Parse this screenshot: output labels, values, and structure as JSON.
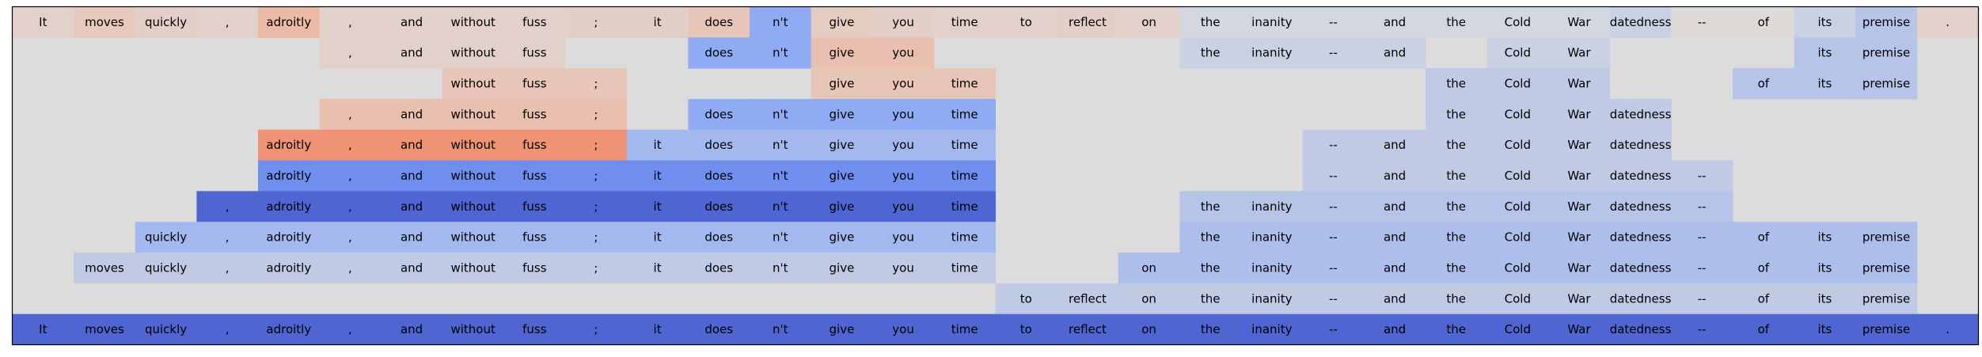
{
  "chart_data": {
    "type": "heatmap",
    "title": "",
    "xlabel": "",
    "ylabel": "",
    "tokens": [
      "It",
      "moves",
      "quickly",
      ",",
      "adroitly",
      ",",
      "and",
      "without",
      "fuss",
      ";",
      "it",
      "does",
      "n't",
      "give",
      "you",
      "time",
      "to",
      "reflect",
      "on",
      "the",
      "inanity",
      "--",
      "and",
      "the",
      "Cold",
      "War",
      "datedness",
      "--",
      "of",
      "its",
      "premise",
      "."
    ],
    "rows": [
      [
        0.1,
        0.18,
        0.12,
        0.1,
        0.3,
        0.1,
        0.1,
        0.1,
        0.1,
        0.12,
        0.12,
        0.2,
        -0.4,
        0.15,
        0.12,
        0.1,
        0.1,
        0.12,
        0.1,
        -0.05,
        -0.05,
        -0.05,
        -0.05,
        -0.05,
        -0.05,
        -0.05,
        -0.1,
        0.03,
        0.03,
        -0.1,
        -0.2,
        0.1
      ],
      [
        null,
        null,
        null,
        null,
        null,
        0.1,
        0.1,
        0.1,
        0.1,
        null,
        null,
        -0.4,
        -0.4,
        0.25,
        0.25,
        null,
        null,
        null,
        null,
        -0.1,
        -0.1,
        -0.1,
        -0.1,
        null,
        -0.1,
        -0.1,
        null,
        null,
        null,
        -0.2,
        -0.2,
        null
      ],
      [
        null,
        null,
        null,
        null,
        null,
        null,
        null,
        0.2,
        0.2,
        0.2,
        null,
        null,
        null,
        0.2,
        0.2,
        0.2,
        null,
        null,
        null,
        null,
        null,
        null,
        null,
        -0.15,
        -0.15,
        -0.15,
        null,
        null,
        -0.2,
        -0.2,
        -0.2,
        null
      ],
      [
        null,
        null,
        null,
        null,
        null,
        0.25,
        0.25,
        0.25,
        0.25,
        0.25,
        null,
        -0.4,
        -0.4,
        -0.4,
        -0.4,
        -0.4,
        null,
        null,
        null,
        null,
        null,
        null,
        null,
        -0.15,
        -0.15,
        -0.15,
        -0.15,
        null,
        null,
        null,
        null,
        null
      ],
      [
        null,
        null,
        null,
        null,
        0.55,
        0.55,
        0.55,
        0.55,
        0.55,
        0.55,
        -0.3,
        -0.3,
        -0.3,
        -0.3,
        -0.3,
        -0.3,
        null,
        null,
        null,
        null,
        null,
        -0.15,
        -0.15,
        -0.15,
        -0.15,
        -0.15,
        -0.15,
        null,
        null,
        null,
        null,
        null
      ],
      [
        null,
        null,
        null,
        null,
        -0.6,
        -0.6,
        -0.6,
        -0.6,
        -0.6,
        -0.6,
        -0.6,
        -0.6,
        -0.6,
        -0.6,
        -0.6,
        -0.6,
        null,
        null,
        null,
        null,
        null,
        -0.15,
        -0.15,
        -0.15,
        -0.15,
        -0.15,
        -0.15,
        -0.15,
        null,
        null,
        null,
        null
      ],
      [
        null,
        null,
        null,
        -0.85,
        -0.85,
        -0.85,
        -0.85,
        -0.85,
        -0.85,
        -0.85,
        -0.85,
        -0.85,
        -0.85,
        -0.85,
        -0.85,
        -0.85,
        null,
        null,
        null,
        -0.2,
        -0.2,
        -0.2,
        -0.2,
        -0.2,
        -0.2,
        -0.2,
        -0.2,
        -0.2,
        null,
        null,
        null,
        null
      ],
      [
        null,
        null,
        -0.3,
        -0.3,
        -0.3,
        -0.3,
        -0.3,
        -0.3,
        -0.3,
        -0.3,
        -0.3,
        -0.3,
        -0.3,
        -0.3,
        -0.3,
        -0.3,
        null,
        null,
        null,
        -0.25,
        -0.25,
        -0.25,
        -0.25,
        -0.25,
        -0.25,
        -0.25,
        -0.25,
        -0.25,
        -0.25,
        -0.25,
        -0.25,
        null
      ],
      [
        null,
        -0.15,
        -0.15,
        -0.15,
        -0.15,
        -0.15,
        -0.15,
        -0.15,
        -0.15,
        -0.15,
        -0.15,
        -0.15,
        -0.15,
        -0.15,
        -0.15,
        -0.15,
        null,
        null,
        -0.25,
        -0.25,
        -0.25,
        -0.25,
        -0.25,
        -0.25,
        -0.25,
        -0.25,
        -0.25,
        -0.25,
        -0.25,
        -0.25,
        -0.25,
        null
      ],
      [
        null,
        null,
        null,
        null,
        null,
        null,
        null,
        null,
        null,
        null,
        null,
        null,
        null,
        null,
        null,
        null,
        -0.15,
        -0.15,
        -0.15,
        -0.15,
        -0.15,
        -0.15,
        -0.15,
        -0.15,
        -0.15,
        -0.15,
        -0.15,
        -0.15,
        -0.15,
        -0.15,
        -0.15,
        null
      ],
      [
        -0.85,
        -0.85,
        -0.85,
        -0.85,
        -0.85,
        -0.85,
        -0.85,
        -0.85,
        -0.85,
        -0.85,
        -0.85,
        -0.85,
        -0.85,
        -0.85,
        -0.85,
        -0.85,
        -0.85,
        -0.85,
        -0.85,
        -0.85,
        -0.85,
        -0.85,
        -0.85,
        -0.85,
        -0.85,
        -0.85,
        -0.85,
        -0.85,
        -0.85,
        -0.85,
        -0.85,
        -0.85
      ]
    ],
    "value_range": [
      -1,
      1
    ],
    "colormap": "coolwarm",
    "empty_color": "#dcdcdc",
    "grid": false,
    "legend": "none"
  }
}
